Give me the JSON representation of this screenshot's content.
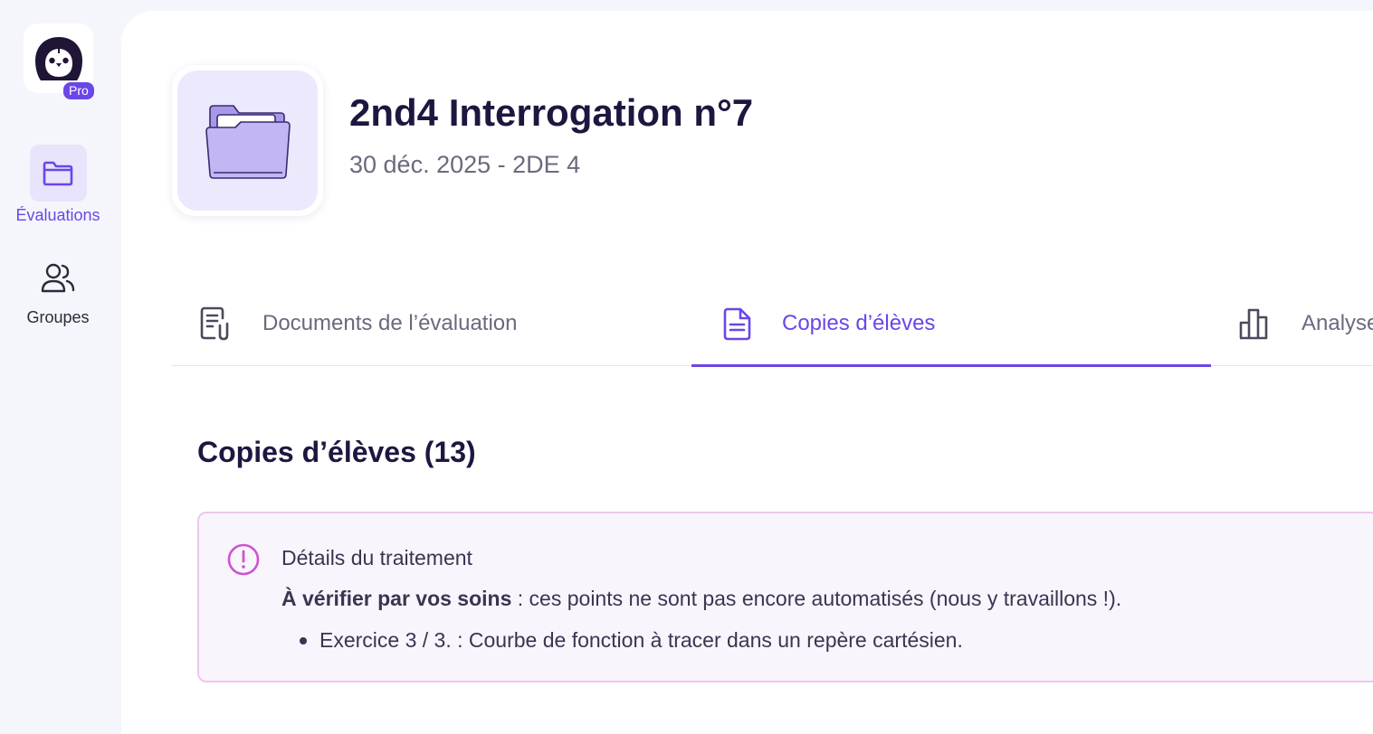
{
  "sidebar": {
    "logo_icon": "penguin-icon",
    "badge": "Pro",
    "items": [
      {
        "label": "Évaluations",
        "icon": "folder-icon",
        "active": true
      },
      {
        "label": "Groupes",
        "icon": "users-icon",
        "active": false
      }
    ]
  },
  "header": {
    "title": "2nd4 Interrogation n°7",
    "subtitle": "30 déc. 2025 - 2DE 4",
    "icon": "open-folder-icon"
  },
  "tabs": [
    {
      "label": "Documents de l’évaluation",
      "icon": "document-clip-icon",
      "active": false
    },
    {
      "label": "Copies d’élèves",
      "icon": "document-icon",
      "active": true
    },
    {
      "label": "Analyse",
      "icon": "bar-chart-icon",
      "active": false
    }
  ],
  "section": {
    "title": "Copies d’élèves (13)"
  },
  "alert": {
    "icon": "exclamation-circle-icon",
    "title": "Détails du traitement",
    "text_strong": "À vérifier par vos soins",
    "text_rest": " : ces points ne sont pas encore automatisés (nous y travaillons !).",
    "items": [
      "Exercice 3 / 3. : Courbe de fonction à tracer dans un repère cartésien."
    ]
  },
  "colors": {
    "accent": "#6b46e8",
    "title": "#1f1640",
    "alert_border": "#edc7ef",
    "alert_icon": "#cc55cc"
  }
}
